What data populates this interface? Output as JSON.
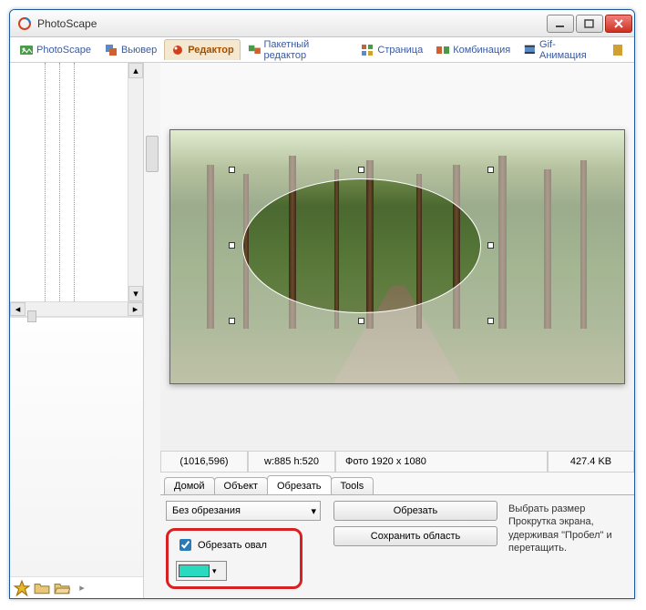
{
  "window": {
    "title": "PhotoScape"
  },
  "main_tabs": [
    "PhotoScape",
    "Вьювер",
    "Редактор",
    "Пакетный редактор",
    "Страница",
    "Комбинация",
    "Gif-Анимация"
  ],
  "main_tab_active": 2,
  "status": {
    "coords": "(1016,596)",
    "dims": "w:885 h:520",
    "photo": "Фото 1920 x 1080",
    "size": "427.4 KB"
  },
  "tool_tabs": [
    "Домой",
    "Объект",
    "Обрезать",
    "Tools"
  ],
  "tool_tab_active": 2,
  "crop_panel": {
    "ratio_dropdown": "Без обрезания",
    "oval_checkbox_label": "Обрезать овал",
    "btn_crop": "Обрезать",
    "btn_save": "Сохранить область",
    "hint": "Выбрать размер\nПрокрутка экрана, удерживая \"Пробел\" и перетащить.",
    "color": "#2adac0"
  }
}
